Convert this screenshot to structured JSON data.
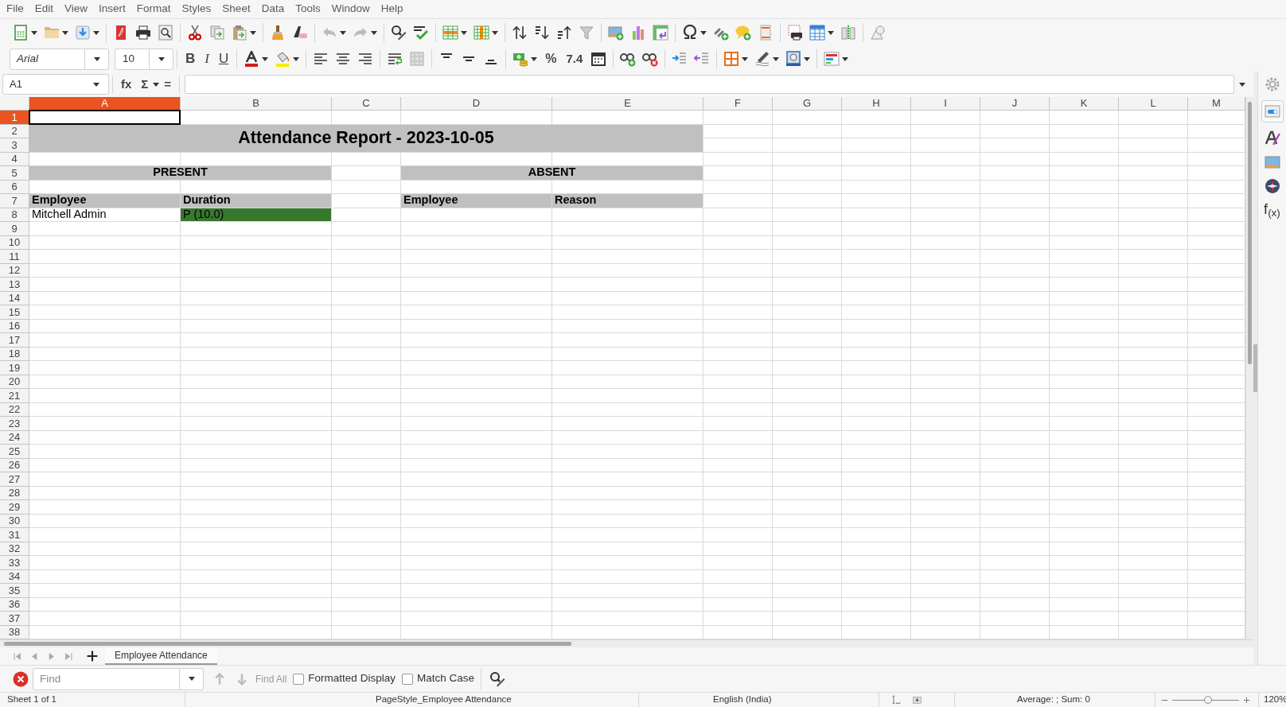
{
  "menu_bar": [
    "File",
    "Edit",
    "View",
    "Insert",
    "Format",
    "Styles",
    "Sheet",
    "Data",
    "Tools",
    "Window",
    "Help"
  ],
  "formatting_toolbar": {
    "font_name": "Arial",
    "font_size": "10",
    "bold": "B",
    "italic": "I",
    "underline": "U",
    "percent": "%",
    "number_format": "7.4"
  },
  "formula_bar": {
    "name_box": "A1",
    "function_wizard": "fx",
    "sum": "Σ",
    "equals": "="
  },
  "sheet": {
    "columns": [
      {
        "label": "A",
        "selected": true
      },
      {
        "label": "B",
        "selected": false
      },
      {
        "label": "C",
        "selected": false
      },
      {
        "label": "D",
        "selected": false
      },
      {
        "label": "E",
        "selected": false
      },
      {
        "label": "F",
        "selected": false
      },
      {
        "label": "G",
        "selected": false
      },
      {
        "label": "H",
        "selected": false
      },
      {
        "label": "I",
        "selected": false
      },
      {
        "label": "J",
        "selected": false
      },
      {
        "label": "K",
        "selected": false
      },
      {
        "label": "L",
        "selected": false
      },
      {
        "label": "M",
        "selected": false
      }
    ],
    "rows": [
      {
        "label": "1",
        "selected": true
      },
      {
        "label": "2",
        "selected": false
      },
      {
        "label": "3",
        "selected": false
      },
      {
        "label": "4",
        "selected": false
      },
      {
        "label": "5",
        "selected": false
      },
      {
        "label": "6",
        "selected": false
      },
      {
        "label": "7",
        "selected": false
      },
      {
        "label": "8",
        "selected": false
      },
      {
        "label": "9",
        "selected": false
      },
      {
        "label": "10",
        "selected": false
      },
      {
        "label": "11",
        "selected": false
      },
      {
        "label": "12",
        "selected": false
      },
      {
        "label": "13",
        "selected": false
      },
      {
        "label": "14",
        "selected": false
      },
      {
        "label": "15",
        "selected": false
      },
      {
        "label": "16",
        "selected": false
      },
      {
        "label": "17",
        "selected": false
      },
      {
        "label": "18",
        "selected": false
      },
      {
        "label": "19",
        "selected": false
      },
      {
        "label": "20",
        "selected": false
      },
      {
        "label": "21",
        "selected": false
      },
      {
        "label": "22",
        "selected": false
      },
      {
        "label": "23",
        "selected": false
      },
      {
        "label": "24",
        "selected": false
      },
      {
        "label": "25",
        "selected": false
      },
      {
        "label": "26",
        "selected": false
      },
      {
        "label": "27",
        "selected": false
      },
      {
        "label": "28",
        "selected": false
      },
      {
        "label": "29",
        "selected": false
      },
      {
        "label": "30",
        "selected": false
      },
      {
        "label": "31",
        "selected": false
      },
      {
        "label": "32",
        "selected": false
      },
      {
        "label": "33",
        "selected": false
      },
      {
        "label": "34",
        "selected": false
      },
      {
        "label": "35",
        "selected": false
      },
      {
        "label": "36",
        "selected": false
      },
      {
        "label": "37",
        "selected": false
      },
      {
        "label": "38",
        "selected": false
      }
    ],
    "report": {
      "title": "Attendance Report - 2023-10-05",
      "sections": [
        {
          "heading": "PRESENT",
          "columns": [
            "Employee",
            "Duration"
          ],
          "rows": [
            {
              "cells": [
                {
                  "text": "Mitchell Admin"
                },
                {
                  "text": "P (10.0)",
                  "color": "#38782e"
                }
              ]
            }
          ]
        },
        {
          "heading": "ABSENT",
          "columns": [
            "Employee",
            "Reason"
          ]
        }
      ]
    }
  },
  "sheet_tabs": [
    {
      "label": "Employee Attendance",
      "selected": true
    }
  ],
  "find_bar": {
    "placeholder": "Find",
    "find_all": {
      "label": "Find All",
      "disabled": true
    },
    "options": [
      {
        "label": "Formatted Display",
        "checked": false
      },
      {
        "label": "Match Case",
        "checked": false
      }
    ]
  },
  "sidebar": {
    "functions_label": "f$_{(x)}$"
  },
  "status_bar": {
    "sheet": "Sheet 1 of 1",
    "page_style": "PageStyle_Employee Attendance",
    "language": "English (India)",
    "selection_summary": "Average: ; Sum: 0",
    "zoom": {
      "level": 0.53,
      "reading": "120%"
    }
  }
}
